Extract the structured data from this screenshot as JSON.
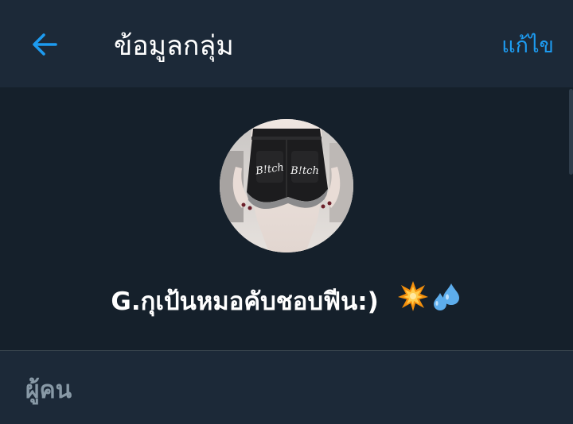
{
  "header": {
    "back_icon": "arrow-left-icon",
    "title": "ข้อมูลกลุ่ม",
    "edit_label": "แก้ไข"
  },
  "group": {
    "name": "G.กุเป้นหมอคับชอบฟีน:)",
    "emoji": [
      "collision-emoji",
      "sweat-droplets-emoji"
    ]
  },
  "sections": {
    "people_label": "ผู้คน"
  },
  "colors": {
    "background": "#15202b",
    "bar_background": "#1c2938",
    "accent": "#1d9bf0",
    "secondary_text": "#8899a6"
  }
}
